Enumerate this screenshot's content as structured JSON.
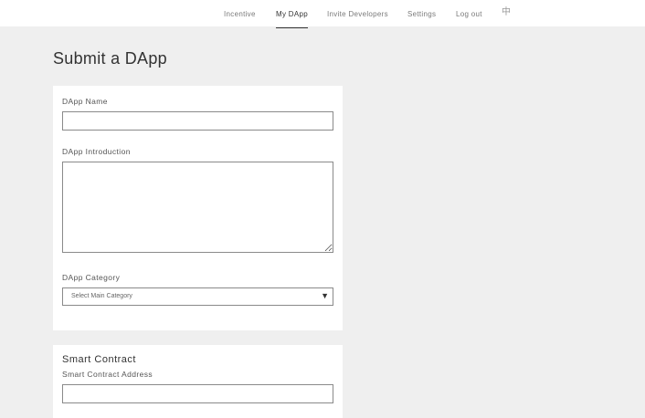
{
  "nav": {
    "items": [
      {
        "label": "Incentive"
      },
      {
        "label": "My DApp"
      },
      {
        "label": "Invite Developers"
      },
      {
        "label": "Settings"
      },
      {
        "label": "Log out"
      }
    ],
    "active": "My DApp",
    "language_icon": "globe-icon",
    "language_glyph": "中"
  },
  "page": {
    "title": "Submit a DApp"
  },
  "form": {
    "dapp_name": {
      "label": "DApp Name",
      "value": "",
      "placeholder": ""
    },
    "dapp_introduction": {
      "label": "DApp Introduction",
      "value": "",
      "placeholder": ""
    },
    "dapp_category": {
      "label": "DApp Category",
      "selected": "Select Main Category"
    },
    "smart_contract": {
      "section_title": "Smart Contract",
      "address": {
        "label": "Smart Contract Address",
        "value": "",
        "placeholder": ""
      }
    }
  }
}
